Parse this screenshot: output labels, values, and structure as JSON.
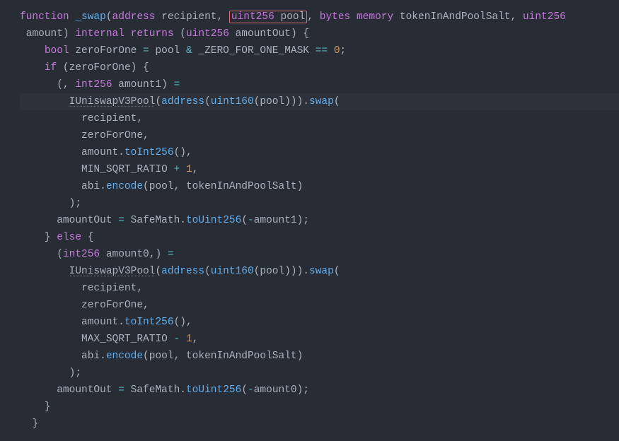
{
  "code": {
    "l1_a": "function",
    "l1_b": "_swap",
    "l1_c": "address",
    "l1_d": "recipient",
    "l1_e": "uint256",
    "l1_f": "pool",
    "l1_g": "bytes",
    "l1_h": "memory",
    "l1_i": "tokenInAndPoolSalt",
    "l1_j": "uint256",
    "l2_a": "amount",
    "l2_b": "internal",
    "l2_c": "returns",
    "l2_d": "uint256",
    "l2_e": "amountOut",
    "l3_a": "bool",
    "l3_b": "zeroForOne",
    "l3_c": "pool",
    "l3_d": "_ZERO_FOR_ONE_MASK",
    "l3_e": "0",
    "l4_a": "if",
    "l4_b": "zeroForOne",
    "l5_a": "int256",
    "l5_b": "amount1",
    "l6_a": "IUniswapV3Pool",
    "l6_b": "address",
    "l6_c": "uint160",
    "l6_d": "pool",
    "l6_e": "swap",
    "l7_a": "recipient",
    "l8_a": "zeroForOne",
    "l9_a": "amount",
    "l9_b": "toInt256",
    "l10_a": "MIN_SQRT_RATIO",
    "l10_b": "1",
    "l11_a": "abi",
    "l11_b": "encode",
    "l11_c": "pool",
    "l11_d": "tokenInAndPoolSalt",
    "l13_a": "amountOut",
    "l13_b": "SafeMath",
    "l13_c": "toUint256",
    "l13_d": "amount1",
    "l14_a": "else",
    "l15_a": "int256",
    "l15_b": "amount0",
    "l16_a": "IUniswapV3Pool",
    "l16_b": "address",
    "l16_c": "uint160",
    "l16_d": "pool",
    "l16_e": "swap",
    "l17_a": "recipient",
    "l18_a": "zeroForOne",
    "l19_a": "amount",
    "l19_b": "toInt256",
    "l20_a": "MAX_SQRT_RATIO",
    "l20_b": "1",
    "l21_a": "abi",
    "l21_b": "encode",
    "l21_c": "pool",
    "l21_d": "tokenInAndPoolSalt",
    "l23_a": "amountOut",
    "l23_b": "SafeMath",
    "l23_c": "toUint256",
    "l23_d": "amount0"
  }
}
